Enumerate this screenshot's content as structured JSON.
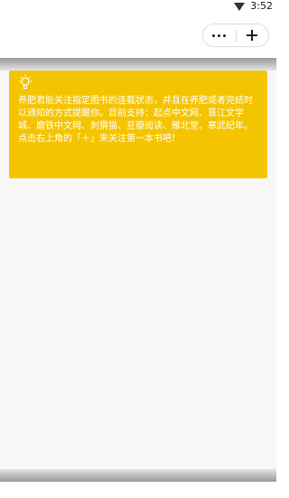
{
  "status_bar": {
    "time": "3:52",
    "signal_icon": "wifi-icon"
  },
  "top_bar": {
    "more_icon": "more-dots-icon",
    "add_icon": "plus-icon"
  },
  "tip_card": {
    "icon": "lightbulb-icon",
    "body": "养肥君能关注指定图书的连载状态，并且在养肥或者完结时以通知的方式提醒你。目前支持：起点中文网、晋江文学城、磨铁中文网、刺猬猫、豆瓣阅读、雁北堂、寒武纪年。",
    "cta": "点击右上角的「＋」来关注第一本书吧！",
    "background_color": "#f5c400",
    "text_color": "#ffffff"
  }
}
